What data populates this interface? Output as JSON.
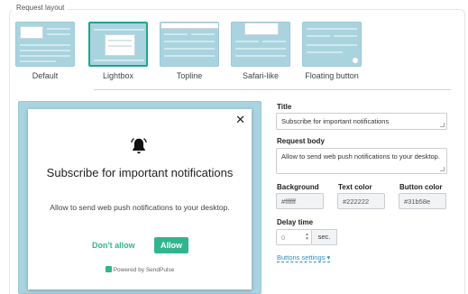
{
  "section": {
    "legend": "Request layout"
  },
  "layouts": [
    {
      "label": "Default",
      "selected": false
    },
    {
      "label": "Lightbox",
      "selected": true
    },
    {
      "label": "Topline",
      "selected": false
    },
    {
      "label": "Safari-like",
      "selected": false
    },
    {
      "label": "Floating button",
      "selected": false
    }
  ],
  "popup": {
    "close_glyph": "✕",
    "title": "Subscribe for important notifications",
    "body": "Allow to send web push notifications to your desktop.",
    "deny_label": "Don't allow",
    "allow_label": "Allow",
    "powered_by": "Powered by SendPulse",
    "icon": "bell-icon"
  },
  "form": {
    "title_label": "Title",
    "title_value": "Subscribe for important notifications",
    "body_label": "Request body",
    "body_value": "Allow  to send web push notifications to your desktop.",
    "background_label": "Background",
    "background_value": "#ffffff",
    "text_color_label": "Text color",
    "text_color_value": "#222222",
    "button_color_label": "Button color",
    "button_color_value": "#31b58e",
    "delay_label": "Delay time",
    "delay_value": "0",
    "delay_unit": "sec.",
    "buttons_settings_link": "Buttons settings ▾"
  },
  "colors": {
    "accent": "#31b58e",
    "preview_bg": "#a9d3df",
    "link": "#2a8fbd"
  }
}
